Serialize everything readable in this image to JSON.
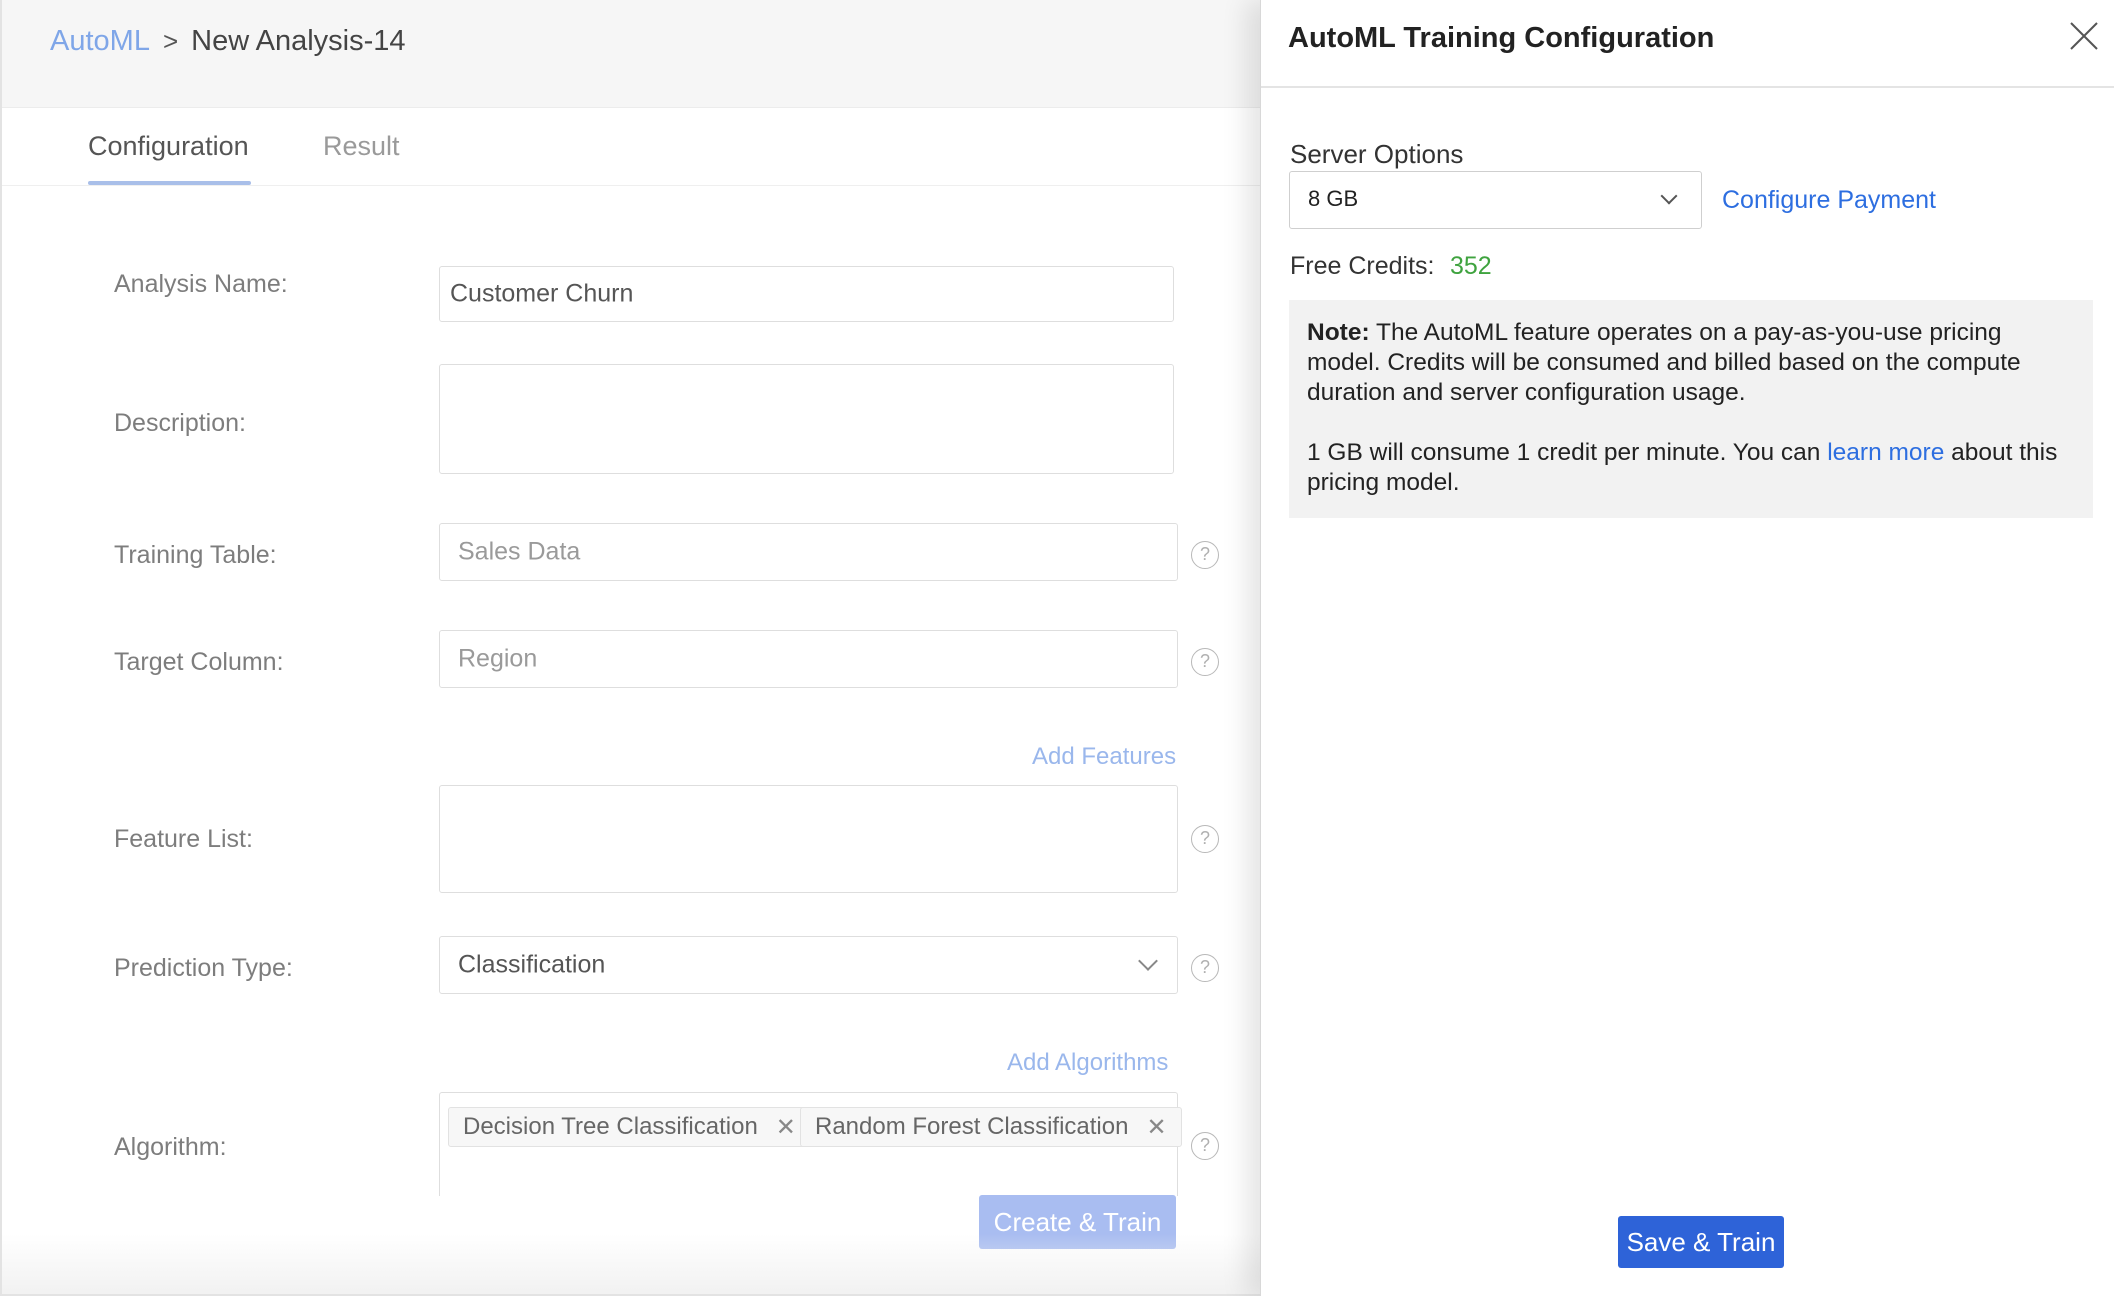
{
  "breadcrumb": {
    "root": "AutoML",
    "separator": ">",
    "current": "New Analysis-14"
  },
  "tabs": [
    {
      "label": "Configuration",
      "active": true
    },
    {
      "label": "Result",
      "active": false
    }
  ],
  "form": {
    "analysis_name": {
      "label": "Analysis Name:",
      "value": "Customer Churn"
    },
    "description": {
      "label": "Description:",
      "value": ""
    },
    "training_table": {
      "label": "Training Table:",
      "value": "Sales Data"
    },
    "target_column": {
      "label": "Target Column:",
      "value": "Region"
    },
    "add_features": "Add Features",
    "feature_list": {
      "label": "Feature List:"
    },
    "prediction_type": {
      "label": "Prediction Type:",
      "value": "Classification"
    },
    "add_algorithms": "Add Algorithms",
    "algorithm": {
      "label": "Algorithm:",
      "chips": [
        "Decision Tree Classification",
        "Random Forest Classification"
      ]
    },
    "create_train": "Create & Train",
    "help_glyph": "?"
  },
  "drawer": {
    "title": "AutoML Training Configuration",
    "server_options_label": "Server Options",
    "server_option_value": "8 GB",
    "configure_payment": "Configure Payment",
    "free_credits_label": "Free Credits:",
    "free_credits_value": "352",
    "note": {
      "bold": "Note:",
      "text1": " The AutoML feature operates on a pay-as-you-use pricing model. Credits will be consumed and billed based on the compute duration and server configuration usage.",
      "text2_before": "1 GB will consume 1 credit per minute. You can ",
      "link": "learn more",
      "text2_after": " about this pricing model."
    },
    "save_train": "Save & Train"
  },
  "colors": {
    "accent": "#2e63d8",
    "link": "#2d6ee0",
    "credits": "#3fa33f",
    "disabled_button": "#a9bdf1"
  },
  "icons": [
    "close-icon",
    "chevron-down-icon",
    "help-icon",
    "remove-chip-icon"
  ]
}
